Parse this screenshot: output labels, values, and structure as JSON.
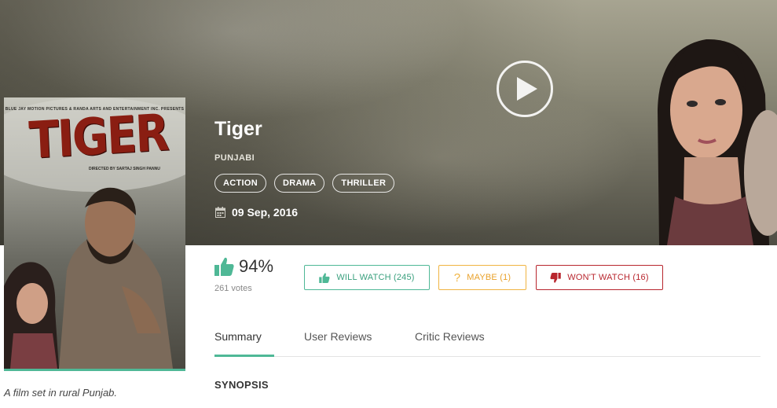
{
  "movie": {
    "title": "Tiger",
    "language": "PUNJABI",
    "genres": [
      "ACTION",
      "DRAMA",
      "THRILLER"
    ],
    "release_date": "09 Sep, 2016",
    "tagline": "A film set in rural Punjab."
  },
  "poster": {
    "credit_line": "BLUE JAY MOTION PICTURES & RANDA ARTS AND ENTERTAINMENT INC. PRESENTS",
    "title": "TIGER",
    "director_line": "DIRECTED BY SARTAJ SINGH PANNU"
  },
  "rating": {
    "percent": "94%",
    "votes": "261 votes"
  },
  "actions": {
    "will_watch": "WILL WATCH (245)",
    "maybe": "MAYBE (1)",
    "wont_watch": "WON'T WATCH (16)"
  },
  "tabs": [
    {
      "label": "Summary",
      "active": true
    },
    {
      "label": "User Reviews",
      "active": false
    },
    {
      "label": "Critic Reviews",
      "active": false
    }
  ],
  "summary": {
    "heading": "SYNOPSIS"
  },
  "icons": {
    "play": "play-icon",
    "calendar": "calendar-icon",
    "thumbs_up": "thumbs-up-icon",
    "question": "question-icon",
    "thumbs_down": "thumbs-down-icon"
  },
  "colors": {
    "accent_green": "#4fb896",
    "maybe_orange": "#f0b441",
    "wont_red": "#b8262e"
  }
}
